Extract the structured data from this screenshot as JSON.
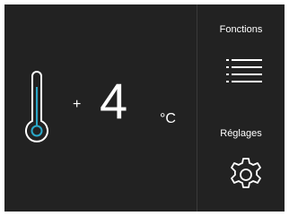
{
  "temperature": {
    "sign": "+",
    "value": "4",
    "unit": "°C"
  },
  "side_menu": {
    "functions_label": "Fonctions",
    "settings_label": "Réglages"
  },
  "colors": {
    "background": "#222222",
    "accent": "#2aa8c8",
    "text": "#ffffff"
  },
  "icons": [
    "thermometer-icon",
    "list-icon",
    "gear-icon"
  ]
}
